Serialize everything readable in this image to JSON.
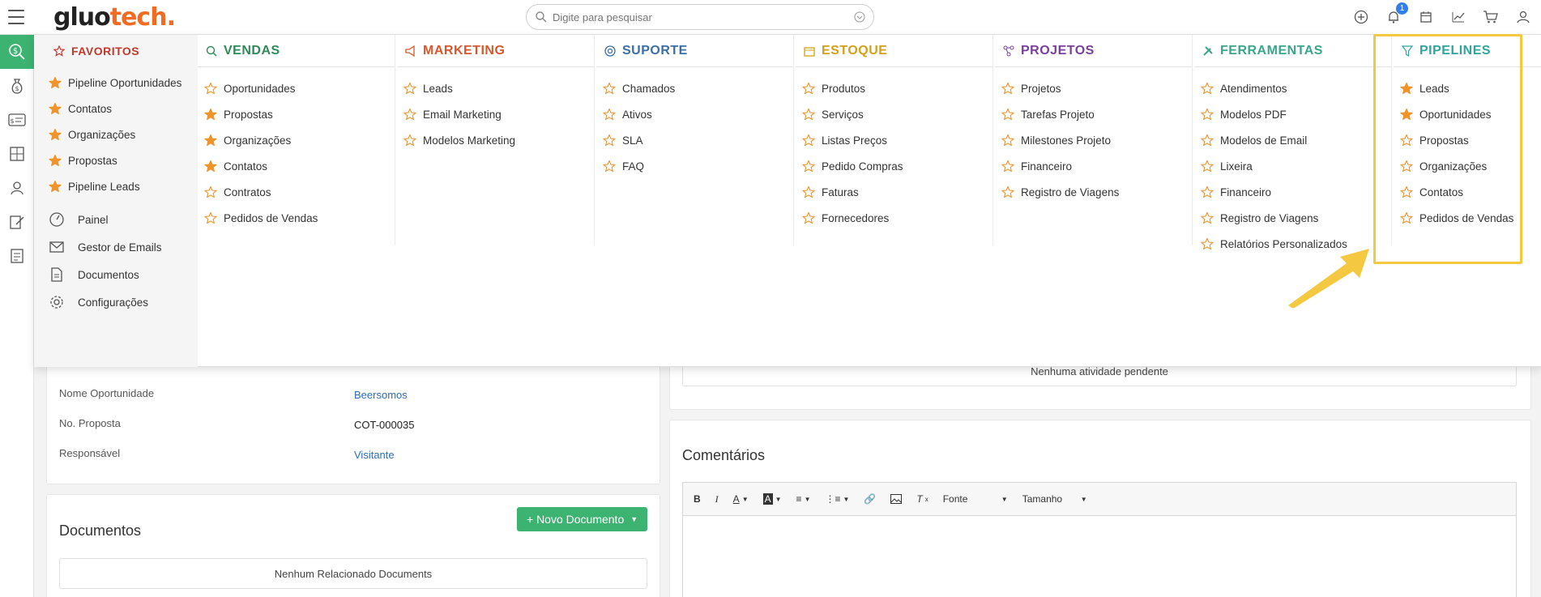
{
  "topbar": {
    "logo_part1": "gluo",
    "logo_part2": "tech.",
    "search_placeholder": "Digite para pesquisar",
    "notification_count": "1"
  },
  "background": {
    "fields": [
      {
        "label": "Nome Oportunidade",
        "value": "Beersomos"
      },
      {
        "label": "No. Proposta",
        "value": "COT-000035"
      },
      {
        "label": "Responsável",
        "value": "Visitante"
      }
    ],
    "documents_title": "Documentos",
    "new_document_label": "+ Novo Documento",
    "documents_empty": "Nenhum Relacionado Documents",
    "activity_empty": "Nenhuma atividade pendente",
    "comments_title": "Comentários",
    "toolbar_font_label": "Fonte",
    "toolbar_size_label": "Tamanho"
  },
  "menu": {
    "favorites": {
      "title": "FAVORITOS",
      "items": [
        "Pipeline Oportunidades",
        "Contatos",
        "Organizações",
        "Propostas",
        "Pipeline Leads"
      ],
      "utilities": [
        "Painel",
        "Gestor de Emails",
        "Documentos",
        "Configurações"
      ]
    },
    "columns": [
      {
        "title": "VENDAS",
        "color": "#2e8b57",
        "items": [
          {
            "label": "Oportunidades",
            "fav": false
          },
          {
            "label": "Propostas",
            "fav": true
          },
          {
            "label": "Organizações",
            "fav": true
          },
          {
            "label": "Contatos",
            "fav": true
          },
          {
            "label": "Contratos",
            "fav": false
          },
          {
            "label": "Pedidos de Vendas",
            "fav": false
          }
        ]
      },
      {
        "title": "MARKETING",
        "color": "#d9572b",
        "items": [
          {
            "label": "Leads",
            "fav": false
          },
          {
            "label": "Email Marketing",
            "fav": false
          },
          {
            "label": "Modelos Marketing",
            "fav": false
          }
        ]
      },
      {
        "title": "SUPORTE",
        "color": "#3b6fa8",
        "items": [
          {
            "label": "Chamados",
            "fav": false
          },
          {
            "label": "Ativos",
            "fav": false
          },
          {
            "label": "SLA",
            "fav": false
          },
          {
            "label": "FAQ",
            "fav": false
          }
        ]
      },
      {
        "title": "ESTOQUE",
        "color": "#d4a017",
        "items": [
          {
            "label": "Produtos",
            "fav": false
          },
          {
            "label": "Serviços",
            "fav": false
          },
          {
            "label": "Listas Preços",
            "fav": false
          },
          {
            "label": "Pedido Compras",
            "fav": false
          },
          {
            "label": "Faturas",
            "fav": false
          },
          {
            "label": "Fornecedores",
            "fav": false
          }
        ]
      },
      {
        "title": "PROJETOS",
        "color": "#7b3fa0",
        "items": [
          {
            "label": "Projetos",
            "fav": false
          },
          {
            "label": "Tarefas Projeto",
            "fav": false
          },
          {
            "label": "Milestones Projeto",
            "fav": false
          },
          {
            "label": "Financeiro",
            "fav": false
          },
          {
            "label": "Registro de Viagens",
            "fav": false
          }
        ]
      },
      {
        "title": "FERRAMENTAS",
        "color": "#3aa68a",
        "items": [
          {
            "label": "Atendimentos",
            "fav": false
          },
          {
            "label": "Modelos PDF",
            "fav": false
          },
          {
            "label": "Modelos de Email",
            "fav": false
          },
          {
            "label": "Lixeira",
            "fav": false
          },
          {
            "label": "Financeiro",
            "fav": false
          },
          {
            "label": "Registro de Viagens",
            "fav": false
          },
          {
            "label": "Relatórios Personalizados",
            "fav": false
          }
        ]
      },
      {
        "title": "PIPELINES",
        "color": "#2fa4a0",
        "items": [
          {
            "label": "Leads",
            "fav": true
          },
          {
            "label": "Oportunidades",
            "fav": true
          },
          {
            "label": "Propostas",
            "fav": false
          },
          {
            "label": "Organizações",
            "fav": false
          },
          {
            "label": "Contatos",
            "fav": false
          },
          {
            "label": "Pedidos de Vendas",
            "fav": false
          }
        ]
      }
    ]
  },
  "colors": {
    "accent_green": "#3cb371",
    "favorite_star": "#f0932b",
    "highlight": "#f5c842"
  }
}
